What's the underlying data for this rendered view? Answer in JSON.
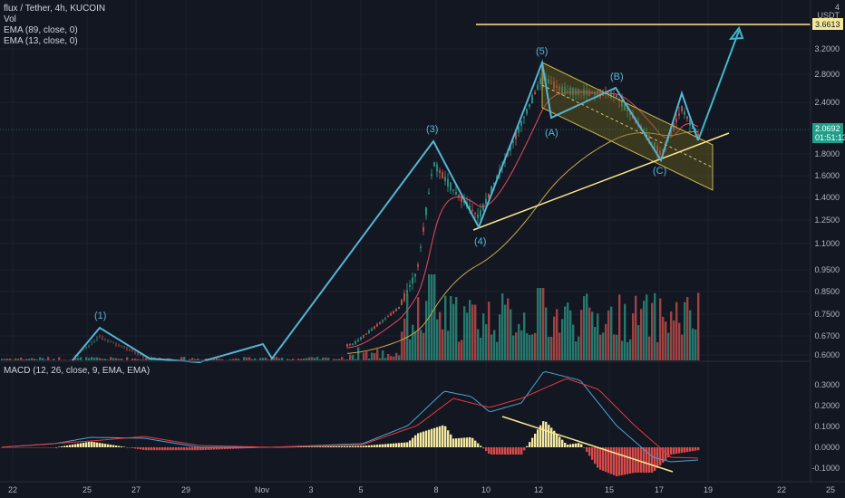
{
  "header": {
    "symbol_line": "flux / Tether, 4h, KUCOIN",
    "indicators": [
      "Vol",
      "EMA (89, close, 0)",
      "EMA (13, close, 0)"
    ]
  },
  "macd_legend": "MACD (12, 26, close, 9, EMA, EMA)",
  "price_axis": {
    "currency": "USDT",
    "top_tick": "4",
    "ticks": [
      "3.2000",
      "2.8000",
      "2.4000",
      "1.8000",
      "1.6000",
      "1.4000",
      "1.2500",
      "1.1000",
      "0.9500",
      "0.8500",
      "0.7500",
      "0.6700",
      "0.6000"
    ],
    "target_label": "3.6613",
    "current_price": "2.0692",
    "countdown": "01:51:13"
  },
  "macd_axis": {
    "ticks": [
      "0.3000",
      "0.2000",
      "0.1000",
      "0.0000",
      "-0.1000"
    ]
  },
  "time_axis": {
    "ticks": [
      "22",
      "25",
      "27",
      "29",
      "Nov",
      "3",
      "5",
      "8",
      "10",
      "12",
      "15",
      "17",
      "19",
      "22",
      "25"
    ]
  },
  "wave_labels": [
    "(1)",
    "(3)",
    "(4)",
    "(5)",
    "(A)",
    "(B)",
    "(C)"
  ],
  "colors": {
    "background": "#131722",
    "wave_line": "#56b4d3",
    "trend_line": "#ffe88a",
    "ema_fast": "#e84a5f",
    "ema_slow": "#c8a84a",
    "macd_line": "#4aa3d8",
    "signal_line": "#e8383a",
    "hist_up": "#f2e8a0",
    "hist_down": "#d84a4a",
    "vol_up": "#2a8a7a",
    "vol_down": "#b84a48",
    "channel_fill": "#6b6420",
    "target_label_bg": "#f5e89a",
    "price_label_bg": "#1f9e8a",
    "arrow": "#3fb8c7"
  }
}
